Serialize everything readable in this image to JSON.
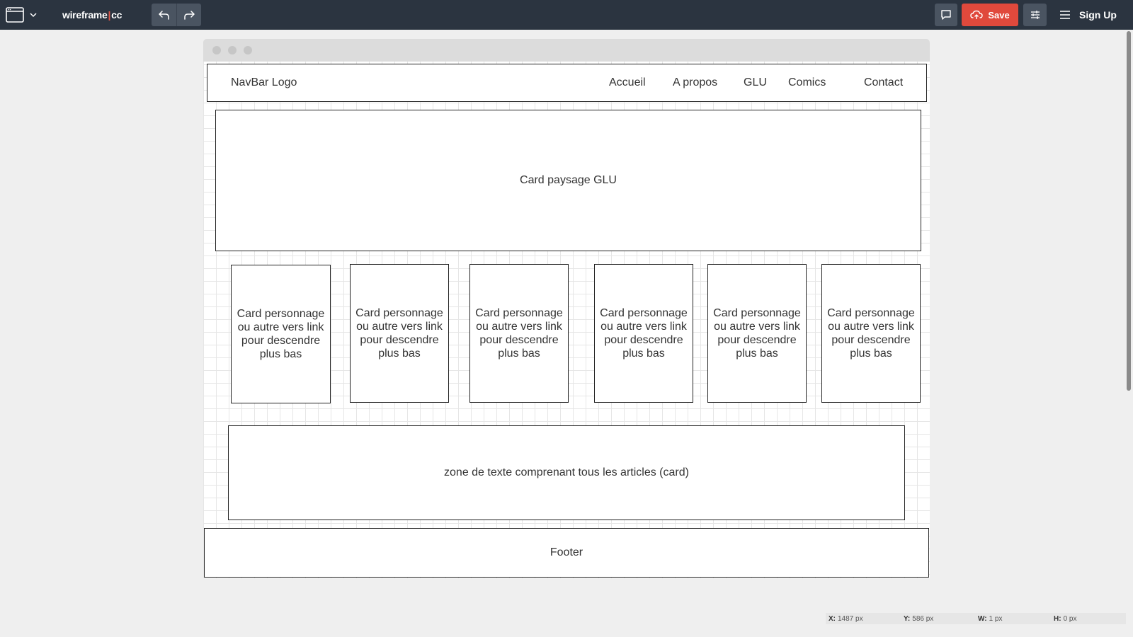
{
  "toolbar": {
    "app_name_left": "wireframe",
    "app_name_right": "cc",
    "save_label": "Save",
    "signup_label": "Sign Up",
    "icons": {
      "window": "browser-window-icon",
      "dropdown": "chevron-down-icon",
      "undo": "undo-icon",
      "redo": "redo-icon",
      "comment": "comment-icon",
      "cloud": "cloud-upload-icon",
      "settings": "sliders-icon",
      "menu": "hamburger-menu-icon"
    },
    "colors": {
      "bar": "#2b3440",
      "save": "#e0493c",
      "logo_accent": "#e2584a"
    }
  },
  "wireframe": {
    "nav": {
      "logo": "NavBar Logo",
      "links": [
        "Accueil",
        "A propos",
        "GLU",
        "Comics",
        "Contact"
      ]
    },
    "hero": "Card paysage GLU",
    "cards": [
      "Card personnage ou autre vers link pour descendre plus bas",
      "Card personnage ou autre vers link pour descendre plus bas",
      "Card personnage ou autre vers link pour descendre plus bas",
      "Card personnage ou autre vers link pour descendre plus bas",
      "Card personnage ou autre vers link pour descendre plus bas",
      "Card personnage ou autre vers link pour descendre plus bas"
    ],
    "articles": "zone de texte comprenant tous les articles (card)",
    "footer": "Footer"
  },
  "statusbar": {
    "x_label": "X:",
    "x_value": "1487 px",
    "y_label": "Y:",
    "y_value": "586 px",
    "w_label": "W:",
    "w_value": "1 px",
    "h_label": "H:",
    "h_value": "0 px"
  }
}
